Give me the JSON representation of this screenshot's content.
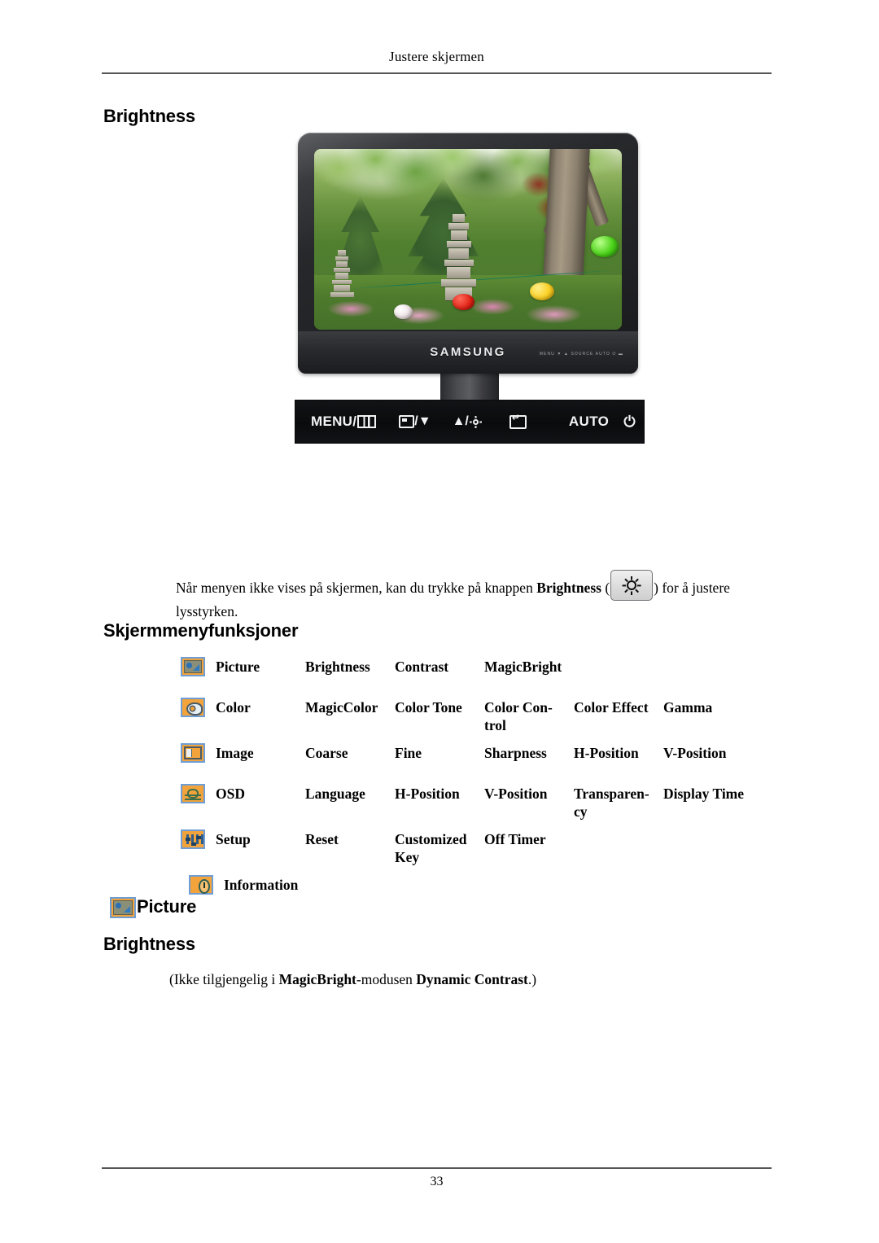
{
  "document": {
    "running_header": "Justere skjermen",
    "page_number": "33"
  },
  "sections": {
    "brightness_top_heading": "Brightness",
    "osd_menu_heading": "Skjermmenyfunksjoner",
    "picture_heading": "Picture",
    "brightness_bottom_heading": "Brightness"
  },
  "monitor": {
    "brand_logo": "SAMSUNG",
    "bezel_key_labels": "MENU      ▼      ▲      SOURCE    AUTO    ⏻    ▬",
    "buttons": [
      {
        "id": "menu",
        "label": "MENU/",
        "icon": "menu-grid-icon"
      },
      {
        "id": "down",
        "label": "/▼",
        "icon": "source-down-icon"
      },
      {
        "id": "up",
        "label": "▲/",
        "icon": "brightness-sun-icon"
      },
      {
        "id": "enter",
        "label": "",
        "icon": "enter-source-icon"
      },
      {
        "id": "auto",
        "label": "AUTO",
        "icon": ""
      },
      {
        "id": "power",
        "label": "⏻",
        "icon": "power-icon"
      },
      {
        "id": "led",
        "label": "",
        "icon": "led-indicator"
      }
    ]
  },
  "paragraph": {
    "part1": "Når menyen ikke vises på skjermen, kan du trykke på knappen ",
    "bold1": "Brightness",
    "part2": " (",
    "part3": ") for å justere lysstyrken."
  },
  "osd_table": {
    "rows": [
      {
        "icon": "picture-menu-icon",
        "label": "Picture",
        "cells": [
          "Brightness",
          "Contrast",
          "MagicBright",
          "",
          "",
          ""
        ]
      },
      {
        "icon": "color-menu-icon",
        "label": "Color",
        "cells": [
          "MagicColor",
          "Color Tone",
          "Color  Con-trol",
          "Color Effect",
          "Gamma",
          ""
        ]
      },
      {
        "icon": "image-menu-icon",
        "label": "Image",
        "cells": [
          "Coarse",
          "Fine",
          "Sharpness",
          "H-Position",
          "V-Position",
          ""
        ]
      },
      {
        "icon": "osd-menu-icon",
        "label": "OSD",
        "cells": [
          "Language",
          "H-Position",
          "V-Position",
          "Transparen-cy",
          "Display Time",
          ""
        ]
      },
      {
        "icon": "setup-menu-icon",
        "label": "Setup",
        "cells": [
          "Reset",
          "Customized Key",
          "Off Timer",
          "",
          "",
          ""
        ]
      },
      {
        "icon": "information-menu-icon",
        "label": "Information",
        "cells": [
          "",
          "",
          "",
          "",
          "",
          ""
        ]
      }
    ]
  },
  "note": {
    "part1": "(Ikke tilgjengelig i ",
    "bold1": "MagicBright",
    "part2": "-modusen ",
    "bold2": "Dynamic Contrast",
    "part3": ".)"
  },
  "colors": {
    "menu_icon_fill": "#f2a33c",
    "menu_icon_border": "#6f9ed4",
    "led_blue": "#1f3ddc",
    "rule_gray": "#555555"
  }
}
